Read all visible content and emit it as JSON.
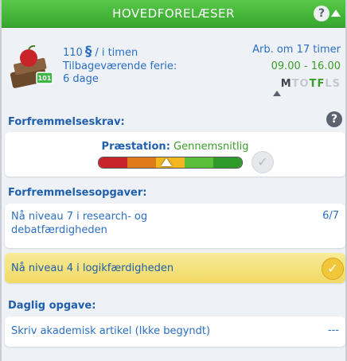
{
  "header": {
    "title": "HOVEDFORELÆSER",
    "help_label": "?"
  },
  "job": {
    "pay_amount": "110",
    "currency_symbol": "§",
    "pay_unit": "/ i timen",
    "vacation_label": "Tilbageværende ferie:",
    "vacation_days": "6 dage",
    "work_in": "Arb. om 17 timer",
    "work_hours": "09.00 - 16.00",
    "days": [
      {
        "letter": "M",
        "working": true
      },
      {
        "letter": "T",
        "working": false
      },
      {
        "letter": "O",
        "working": false
      },
      {
        "letter": "T",
        "working": true
      },
      {
        "letter": "F",
        "working": true
      },
      {
        "letter": "L",
        "working": false
      },
      {
        "letter": "S",
        "working": false
      }
    ]
  },
  "promotion": {
    "requirements_label": "Forfremmelseskrav:",
    "help_label": "?",
    "performance_key": "Præstation:",
    "performance_value": "Gennemsnitlig",
    "performance_level": 0.47,
    "bar_colors": [
      "#c8242a",
      "#e07b1c",
      "#f2b61f",
      "#5cbf3a",
      "#2e9b2a"
    ],
    "check_symbol": "✓"
  },
  "tasks": {
    "label": "Forfremmelsesopgaver:",
    "items": [
      {
        "text_line1": "Nå niveau 7 i research- og",
        "text_line2": "debatfærdigheden",
        "progress": "6/7",
        "done": false
      },
      {
        "text": "Nå niveau 4 i logikfærdigheden",
        "done": true,
        "check_symbol": "✓"
      }
    ]
  },
  "daily": {
    "label": "Daglig opgave:",
    "text": "Skriv akademisk artikel (Ikke begyndt)",
    "progress": "---"
  }
}
